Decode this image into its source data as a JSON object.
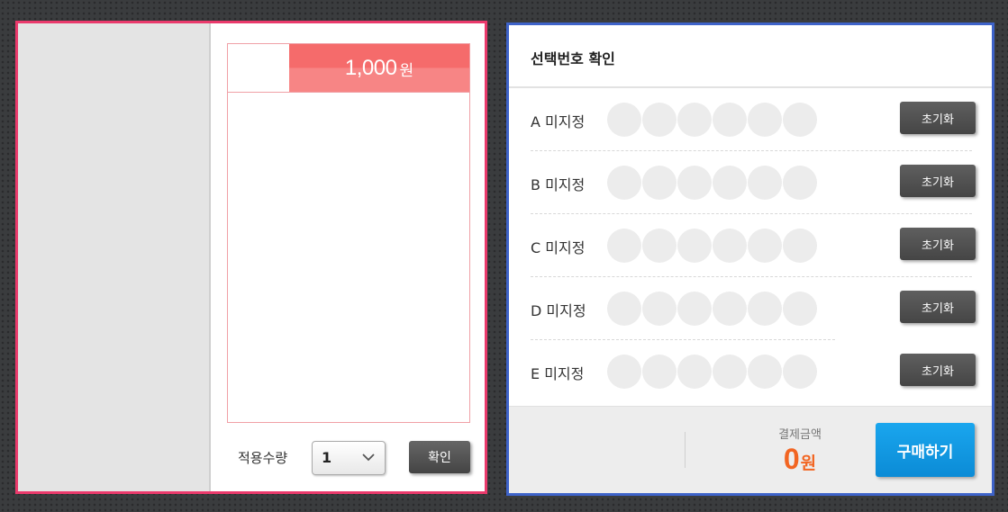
{
  "ticket": {
    "price": "1,000",
    "currency": "원"
  },
  "quantity": {
    "label": "적용수량",
    "selected": "1"
  },
  "buttons": {
    "confirm": "확인",
    "reset": "초기화",
    "buy": "구매하기"
  },
  "selection": {
    "title": "선택번호 확인",
    "rows": [
      {
        "letter": "A",
        "status": "미지정",
        "balls": [
          "",
          "",
          "",
          "",
          "",
          ""
        ]
      },
      {
        "letter": "B",
        "status": "미지정",
        "balls": [
          "",
          "",
          "",
          "",
          "",
          ""
        ]
      },
      {
        "letter": "C",
        "status": "미지정",
        "balls": [
          "",
          "",
          "",
          "",
          "",
          ""
        ]
      },
      {
        "letter": "D",
        "status": "미지정",
        "balls": [
          "",
          "",
          "",
          "",
          "",
          ""
        ]
      },
      {
        "letter": "E",
        "status": "미지정",
        "balls": [
          "",
          "",
          "",
          "",
          "",
          ""
        ]
      }
    ]
  },
  "payment": {
    "label": "결제금액",
    "amount": "0",
    "unit": "원"
  },
  "colors": {
    "left_border": "#ea3a6c",
    "right_border": "#3e63c9",
    "price_bar": "#f56b6b",
    "amount": "#f26522",
    "buy_button": "#0b8bd6"
  }
}
